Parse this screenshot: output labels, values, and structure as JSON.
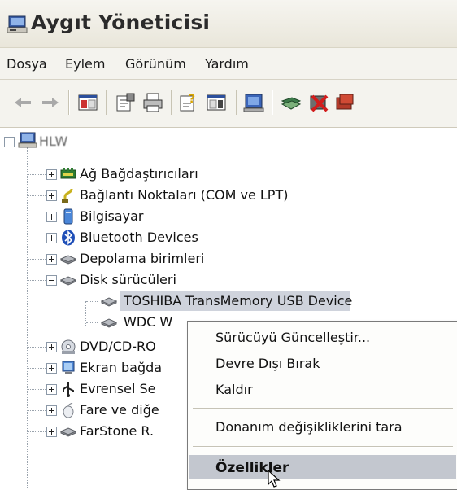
{
  "window": {
    "title": "Aygıt Yöneticisi"
  },
  "menu": [
    "Dosya",
    "Eylem",
    "Görünüm",
    "Yardım"
  ],
  "toolbar": [
    "back-arrow-icon",
    "forward-arrow-icon",
    "console-tree-icon",
    "properties-icon",
    "print-icon",
    "help-icon",
    "view-icon",
    "scan-hardware-icon",
    "update-driver-icon",
    "uninstall-icon",
    "disable-icon"
  ],
  "tree": {
    "root": "HLW",
    "items": [
      {
        "label": "Ağ Bağdaştırıcıları",
        "icon": "network-adapter-icon"
      },
      {
        "label": "Bağlantı Noktaları (COM ve LPT)",
        "icon": "port-icon"
      },
      {
        "label": "Bilgisayar",
        "icon": "computer-icon"
      },
      {
        "label": "Bluetooth Devices",
        "icon": "bluetooth-icon"
      },
      {
        "label": "Depolama birimleri",
        "icon": "storage-icon"
      },
      {
        "label": "Disk sürücüleri",
        "icon": "disk-drive-icon",
        "children": [
          {
            "label": "TOSHIBA TransMemory USB Device",
            "icon": "disk-drive-icon"
          },
          {
            "label": "WDC W",
            "icon": "disk-drive-icon"
          }
        ]
      },
      {
        "label": "DVD/CD-RO",
        "icon": "cdrom-icon"
      },
      {
        "label": "Ekran bağda",
        "icon": "display-adapter-icon"
      },
      {
        "label": "Evrensel Se",
        "icon": "usb-icon"
      },
      {
        "label": "Fare ve diğe",
        "icon": "mouse-icon"
      },
      {
        "label": "FarStone R.",
        "icon": "disk-drive-icon"
      }
    ]
  },
  "context_menu": {
    "items": [
      "Sürücüyü Güncelleştir...",
      "Devre Dışı Bırak",
      "Kaldır",
      "Donanım değişikliklerini tara",
      "Özellikler"
    ],
    "highlighted": "Özellikler"
  }
}
